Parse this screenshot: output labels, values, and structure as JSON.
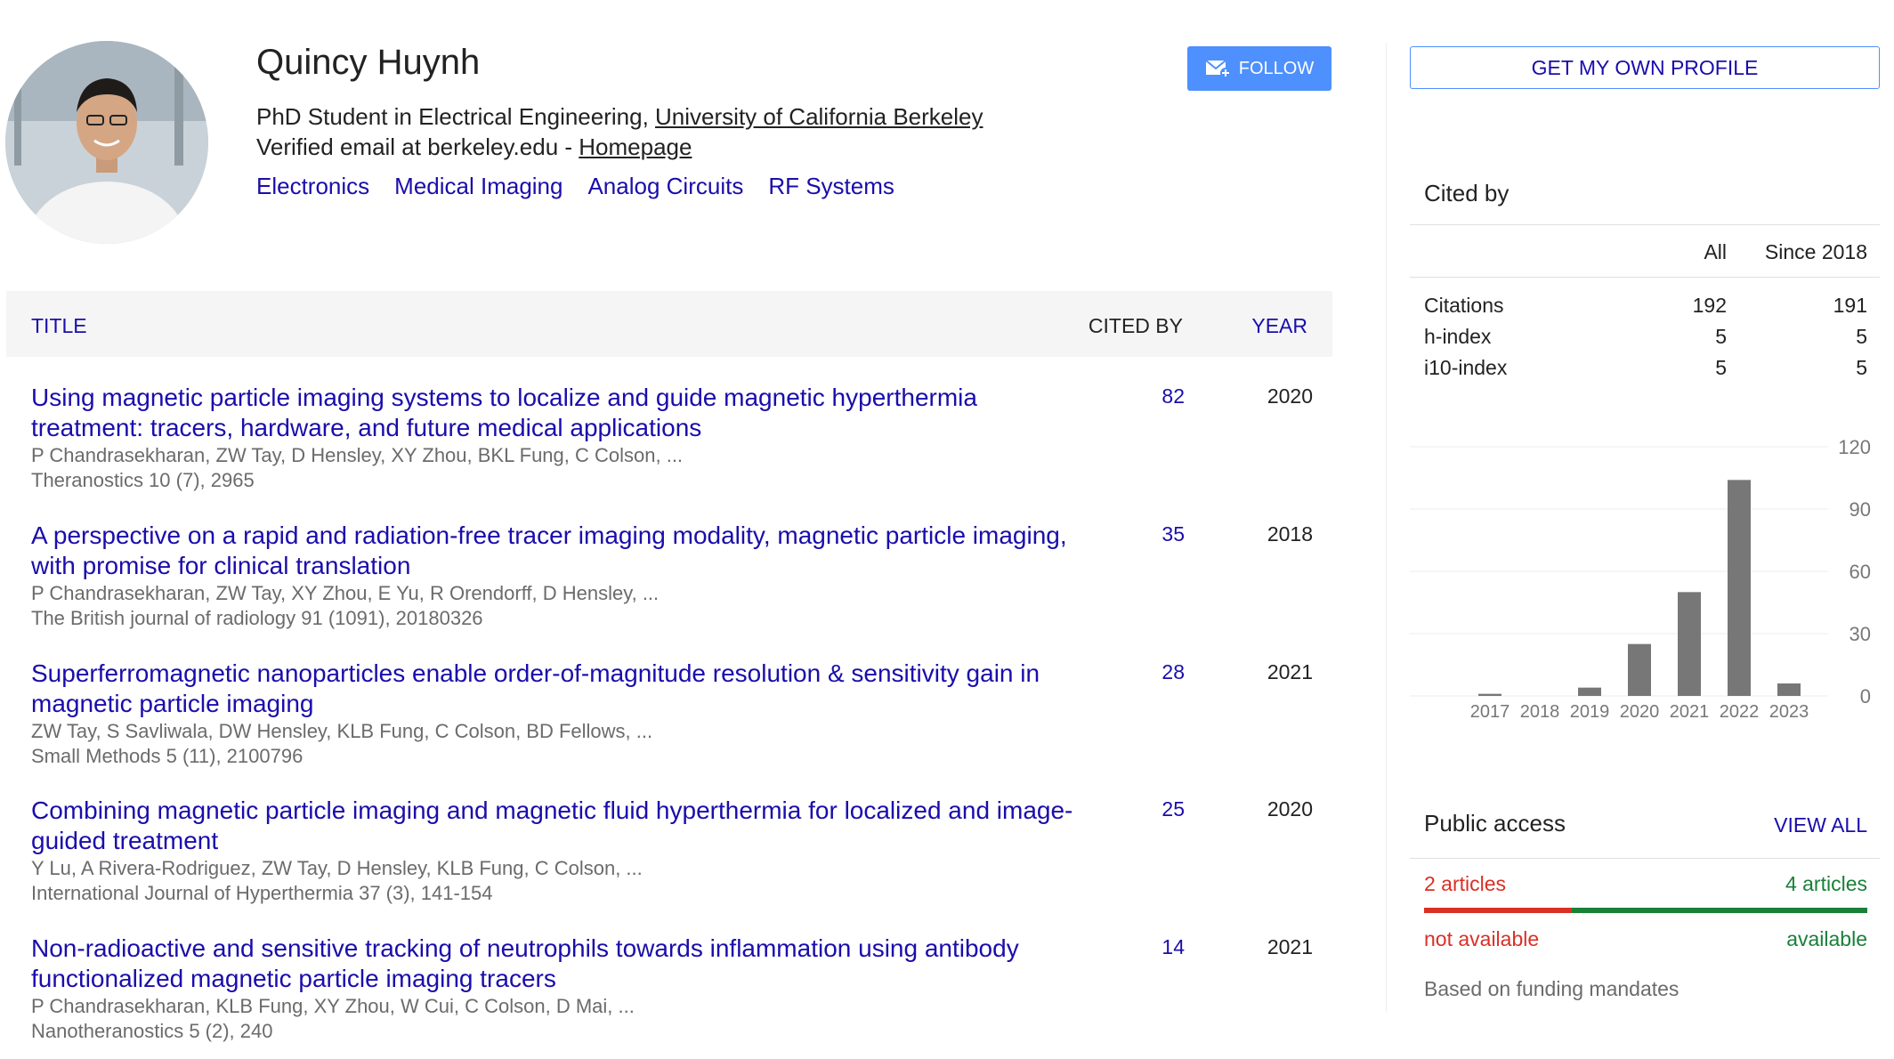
{
  "profile": {
    "name": "Quincy Huynh",
    "affiliation_prefix": "PhD Student in Electrical Engineering, ",
    "affiliation_link": "University of California Berkeley",
    "email_text": "Verified email at berkeley.edu - ",
    "homepage_link": "Homepage",
    "interests": [
      "Electronics",
      "Medical Imaging",
      "Analog Circuits",
      "RF Systems"
    ],
    "follow_label": "FOLLOW"
  },
  "table": {
    "col_title": "TITLE",
    "col_cited": "CITED BY",
    "col_year": "YEAR",
    "articles": [
      {
        "title": "Using magnetic particle imaging systems to localize and guide magnetic hyperthermia treatment: tracers, hardware, and future medical applications",
        "authors": "P Chandrasekharan, ZW Tay, D Hensley, XY Zhou, BKL Fung, C Colson, ...",
        "venue": "Theranostics 10 (7), 2965",
        "cited": "82",
        "year": "2020"
      },
      {
        "title": "A perspective on a rapid and radiation-free tracer imaging modality, magnetic particle imaging, with promise for clinical translation",
        "authors": "P Chandrasekharan, ZW Tay, XY Zhou, E Yu, R Orendorff, D Hensley, ...",
        "venue": "The British journal of radiology 91 (1091), 20180326",
        "cited": "35",
        "year": "2018"
      },
      {
        "title": "Superferromagnetic nanoparticles enable order-of-magnitude resolution & sensitivity gain in magnetic particle imaging",
        "authors": "ZW Tay, S Savliwala, DW Hensley, KLB Fung, C Colson, BD Fellows, ...",
        "venue": "Small Methods 5 (11), 2100796",
        "cited": "28",
        "year": "2021"
      },
      {
        "title": "Combining magnetic particle imaging and magnetic fluid hyperthermia for localized and image-guided treatment",
        "authors": "Y Lu, A Rivera-Rodriguez, ZW Tay, D Hensley, KLB Fung, C Colson, ...",
        "venue": "International Journal of Hyperthermia 37 (3), 141-154",
        "cited": "25",
        "year": "2020"
      },
      {
        "title": "Non-radioactive and sensitive tracking of neutrophils towards inflammation using antibody functionalized magnetic particle imaging tracers",
        "authors": "P Chandrasekharan, KLB Fung, XY Zhou, W Cui, C Colson, D Mai, ...",
        "venue": "Nanotheranostics 5 (2), 240",
        "cited": "14",
        "year": "2021"
      }
    ]
  },
  "sidebar": {
    "get_profile_label": "GET MY OWN PROFILE",
    "cited_by_title": "Cited by",
    "col_all": "All",
    "col_since": "Since 2018",
    "metrics": [
      {
        "label": "Citations",
        "all": "192",
        "since": "191"
      },
      {
        "label": "h-index",
        "all": "5",
        "since": "5"
      },
      {
        "label": "i10-index",
        "all": "5",
        "since": "5"
      }
    ],
    "public_access": {
      "title": "Public access",
      "view_all": "VIEW ALL",
      "not_available_count": "2 articles",
      "available_count": "4 articles",
      "not_available_label": "not available",
      "available_label": "available",
      "not_available_fraction": 0.333,
      "note": "Based on funding mandates",
      "color_not_available": "#d93025",
      "color_available": "#188038"
    }
  },
  "chart_data": {
    "type": "bar",
    "categories": [
      "2017",
      "2018",
      "2019",
      "2020",
      "2021",
      "2022",
      "2023"
    ],
    "values": [
      1,
      0,
      4,
      25,
      50,
      104,
      6
    ],
    "ylim": [
      0,
      120
    ],
    "yticks": [
      "0",
      "30",
      "60",
      "90",
      "120"
    ],
    "grid": true,
    "bar_color": "#777777"
  }
}
